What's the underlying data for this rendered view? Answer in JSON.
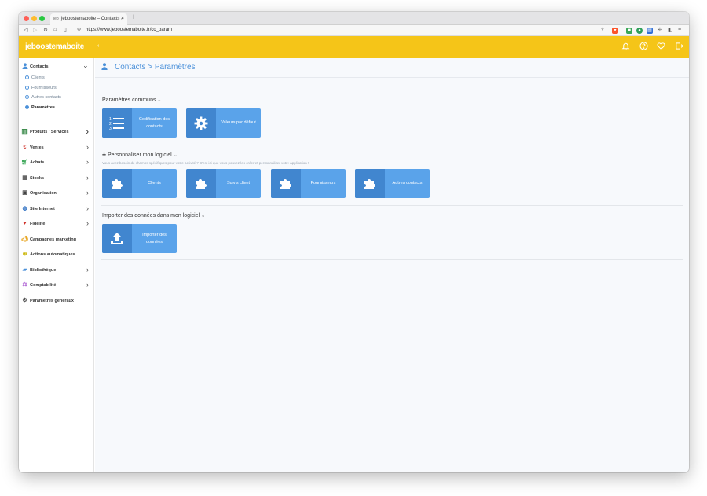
{
  "browser": {
    "tab_title": "jeboostemaboite – Contacts >",
    "tab_favicon": "jeb",
    "new_tab": "+",
    "url": "https://www.jeboostemaboite.fr/co_param"
  },
  "header": {
    "logo": "jeboostemaboite",
    "collapse": "‹",
    "icons": [
      "bell-icon",
      "help-icon",
      "heart-icon",
      "logout-icon"
    ],
    "color": "#f5c518"
  },
  "sidebar": {
    "contacts": {
      "label": "Contacts",
      "subitems": [
        "Clients",
        "Fournisseurs",
        "Autres contacts",
        "Paramètres"
      ]
    },
    "items": [
      {
        "label": "Produits / Services",
        "icon": "barcode-icon",
        "chevron": true
      },
      {
        "label": "Ventes",
        "icon": "euro-icon",
        "chevron": true
      },
      {
        "label": "Achats",
        "icon": "cart-icon",
        "chevron": true
      },
      {
        "label": "Stocks",
        "icon": "boxes-icon",
        "chevron": true
      },
      {
        "label": "Organisation",
        "icon": "calendar-icon",
        "chevron": true
      },
      {
        "label": "Site Internet",
        "icon": "globe-icon",
        "chevron": true
      },
      {
        "label": "Fidélité",
        "icon": "heart-icon",
        "chevron": true
      },
      {
        "label": "Campagnes marketing",
        "icon": "megaphone-icon",
        "chevron": false
      },
      {
        "label": "Actions automatiques",
        "icon": "auto-icon",
        "chevron": false
      },
      {
        "label": "Bibliothèque",
        "icon": "folder-icon",
        "chevron": true
      },
      {
        "label": "Comptabilité",
        "icon": "scales-icon",
        "chevron": true
      },
      {
        "label": "Paramètres généraux",
        "icon": "gear-icon",
        "chevron": false
      }
    ]
  },
  "main": {
    "title": "Contacts > Paramètres",
    "sections": {
      "common": {
        "title": "Paramètres communs",
        "tiles": [
          {
            "label": "Codification des contacts",
            "icon": "list-numbered-icon"
          },
          {
            "label": "Valeurs par défaut",
            "icon": "gear-icon"
          }
        ]
      },
      "custom": {
        "title": "Personnaliser mon logiciel",
        "subtitle": "Vous avez besoin de champs spécifiques pour votre activité ? C'est ici que vous pouvez les créer et personnaliser votre application !",
        "tiles": [
          {
            "label": "Clients",
            "icon": "puzzle-icon"
          },
          {
            "label": "Suivis client",
            "icon": "puzzle-icon"
          },
          {
            "label": "Fournisseurs",
            "icon": "puzzle-icon"
          },
          {
            "label": "Autres contacts",
            "icon": "puzzle-icon"
          }
        ]
      },
      "import": {
        "title": "Importer des données dans mon logiciel",
        "tiles": [
          {
            "label": "Importer des données",
            "icon": "upload-icon"
          }
        ]
      }
    },
    "tile_color": "#5aa3ea",
    "tile_icon_bg": "#4186cf",
    "accent": "#4a90d9"
  }
}
